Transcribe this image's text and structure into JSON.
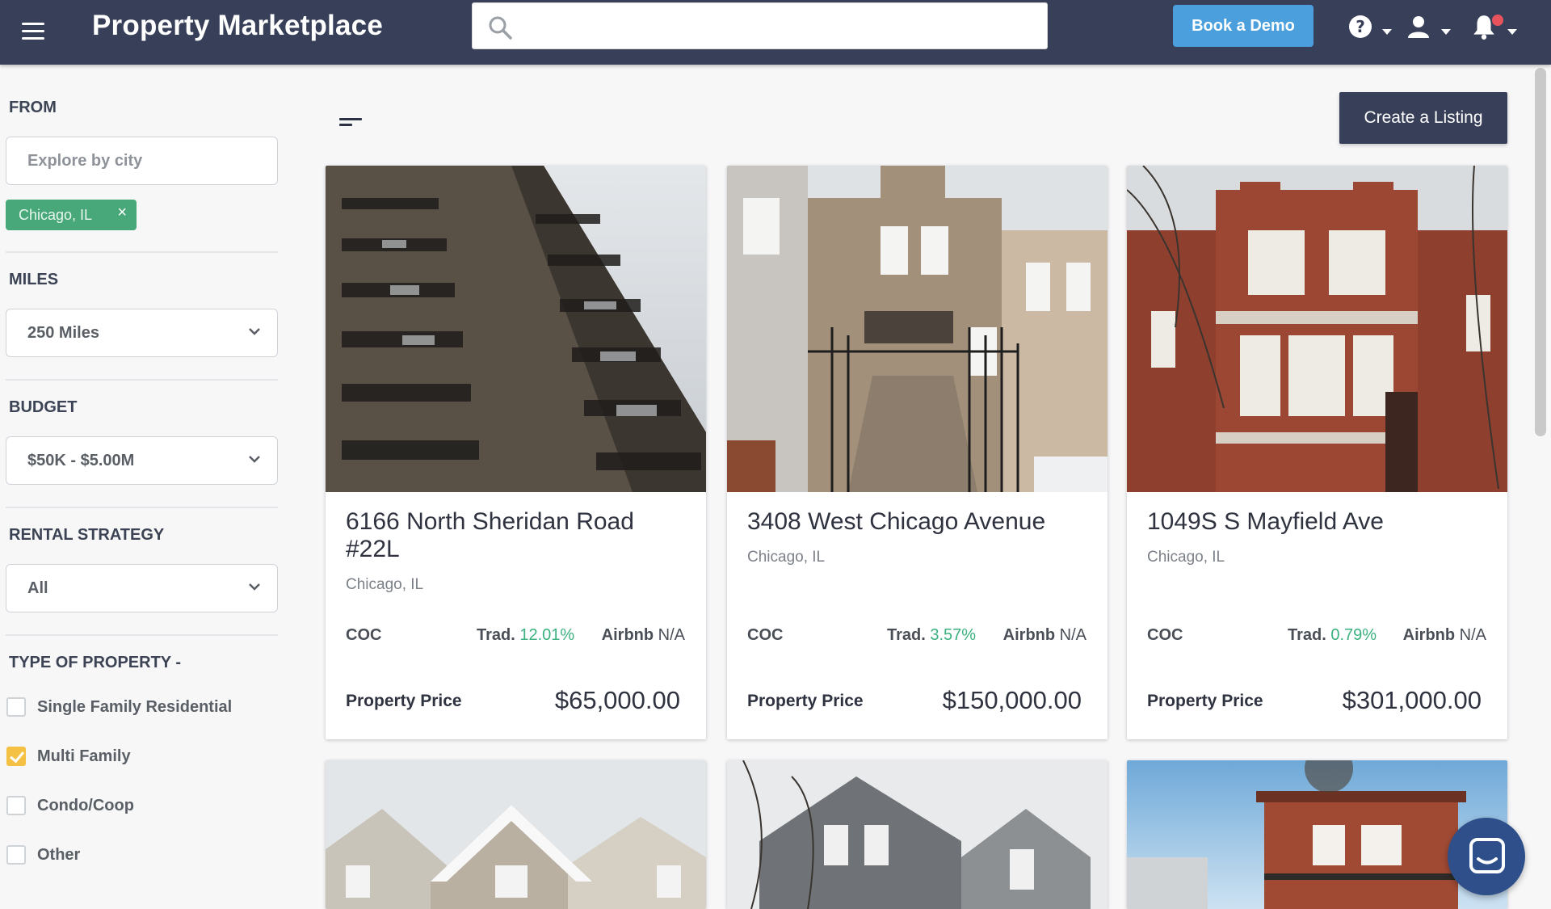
{
  "header": {
    "app_title": "Property Marketplace",
    "search_placeholder": "",
    "book_demo_label": "Book a Demo",
    "icons": [
      "menu-icon",
      "search-icon",
      "help-icon",
      "user-icon",
      "bell-icon"
    ]
  },
  "sidebar": {
    "from_title": "FROM",
    "city_placeholder": "Explore by city",
    "city_chip": "Chicago, IL",
    "chip_close": "×",
    "miles_title": "MILES",
    "miles_value": "250 Miles",
    "budget_title": "BUDGET",
    "budget_value": "$50K - $5.00M",
    "strategy_title": "RENTAL STRATEGY",
    "strategy_value": "All",
    "type_title": "TYPE OF PROPERTY -",
    "property_types": [
      {
        "label": "Single Family Residential",
        "checked": false
      },
      {
        "label": "Multi Family",
        "checked": true
      },
      {
        "label": "Condo/Coop",
        "checked": false
      },
      {
        "label": "Other",
        "checked": false
      }
    ]
  },
  "main": {
    "create_listing_label": "Create a Listing",
    "listings": [
      {
        "address": "6166 North Sheridan Road #22L",
        "city": "Chicago, IL",
        "coc_label": "COC",
        "trad_label": "Trad.",
        "trad_value": "12.01%",
        "airbnb_label": "Airbnb",
        "airbnb_value": "N/A",
        "price_label": "Property Price",
        "price": "$65,000.00"
      },
      {
        "address": "3408 West Chicago Avenue",
        "city": "Chicago, IL",
        "coc_label": "COC",
        "trad_label": "Trad.",
        "trad_value": "3.57%",
        "airbnb_label": "Airbnb",
        "airbnb_value": "N/A",
        "price_label": "Property Price",
        "price": "$150,000.00"
      },
      {
        "address": "1049S S Mayfield Ave",
        "city": "Chicago, IL",
        "coc_label": "COC",
        "trad_label": "Trad.",
        "trad_value": "0.79%",
        "airbnb_label": "Airbnb",
        "airbnb_value": "N/A",
        "price_label": "Property Price",
        "price": "$301,000.00"
      }
    ]
  },
  "colors": {
    "header_bg": "#384059",
    "accent_blue": "#4a9fdc",
    "chip_green": "#49a87a",
    "pct_green": "#3bb17f",
    "checkbox_yellow": "#f4c145",
    "chat_blue": "#2e4f89"
  }
}
